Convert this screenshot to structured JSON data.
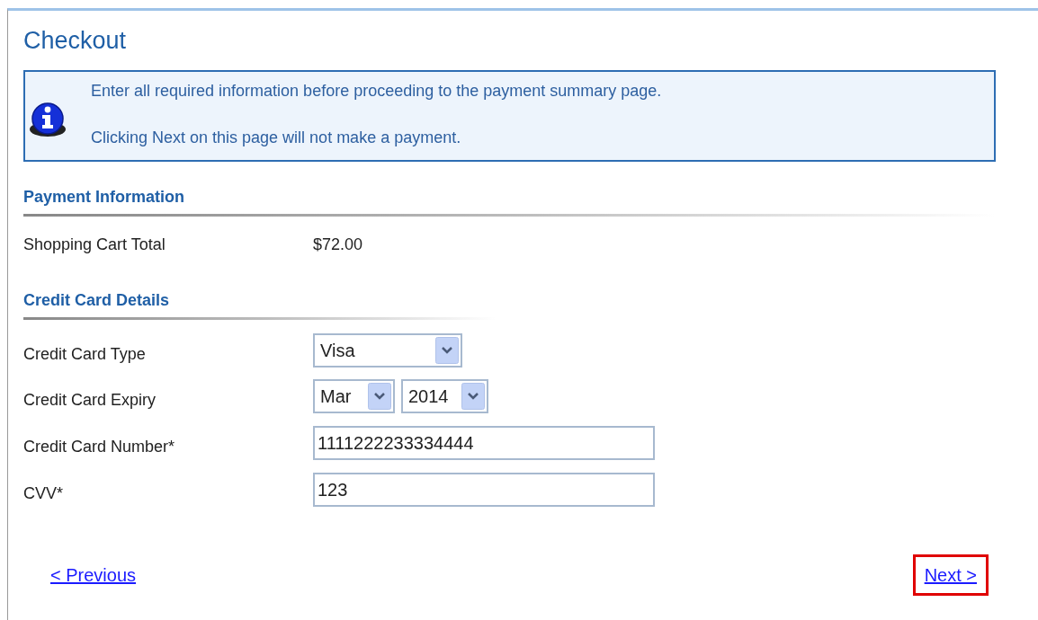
{
  "title": "Checkout",
  "info": {
    "lines": [
      "Enter all required information before proceeding to the payment summary page.",
      "Clicking Next on this page will not make a payment."
    ]
  },
  "payment_information": {
    "heading": "Payment Information",
    "rows": [
      {
        "label": "Shopping Cart Total",
        "value": "$72.00"
      }
    ]
  },
  "credit_card_details": {
    "heading": "Credit Card Details",
    "rows": [
      {
        "label": "Credit Card Type",
        "controls": [
          {
            "kind": "select",
            "value": "Visa"
          }
        ]
      },
      {
        "label": "Credit Card Expiry",
        "controls": [
          {
            "kind": "select",
            "value": "Mar"
          },
          {
            "kind": "select",
            "value": "2014"
          }
        ]
      },
      {
        "label": "Credit Card Number*",
        "controls": [
          {
            "kind": "input",
            "value": "1111222233334444"
          }
        ]
      },
      {
        "label": "CVV*",
        "controls": [
          {
            "kind": "input",
            "value": "123"
          }
        ]
      }
    ]
  },
  "navigation": [
    {
      "label": "< Previous",
      "highlighted": false
    },
    {
      "label": "Next >",
      "highlighted": true
    }
  ]
}
